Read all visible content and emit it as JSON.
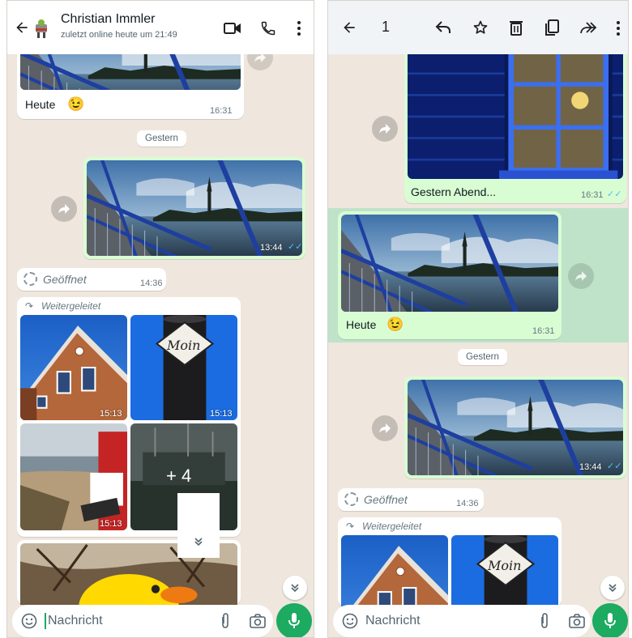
{
  "left": {
    "header": {
      "contact_name": "Christian Immler",
      "status": "zuletzt online heute um 21:49"
    },
    "messages": {
      "heute_caption": "Heute",
      "heute_time": "16:31",
      "date_chip": "Gestern",
      "bridge_time": "13:44",
      "geoffnet_label": "Geöffnet",
      "geoffnet_time": "14:36",
      "forwarded_label": "Weitergeleitet",
      "grid_time_1": "15:13",
      "grid_time_2": "15:13",
      "grid_time_3": "15:13",
      "grid_more": "+ 4",
      "moin_text": "Moin"
    },
    "input": {
      "placeholder": "Nachricht"
    }
  },
  "right": {
    "header": {
      "selected_count": "1"
    },
    "messages": {
      "gestern_abend_caption": "Gestern Abend...",
      "gestern_abend_time": "16:31",
      "heute_caption": "Heute",
      "heute_time": "16:31",
      "date_chip": "Gestern",
      "bridge_time": "13:44",
      "geoffnet_label": "Geöffnet",
      "geoffnet_time": "14:36",
      "forwarded_label": "Weitergeleitet",
      "moin_text": "Moin"
    },
    "input": {
      "placeholder": "Nachricht"
    }
  },
  "colors": {
    "chat_bg": "#efe7de",
    "outgoing": "#d9fdd3",
    "selection": "#bfe3c8",
    "accent_green": "#1daa61",
    "read_ticks": "#53bdeb"
  }
}
